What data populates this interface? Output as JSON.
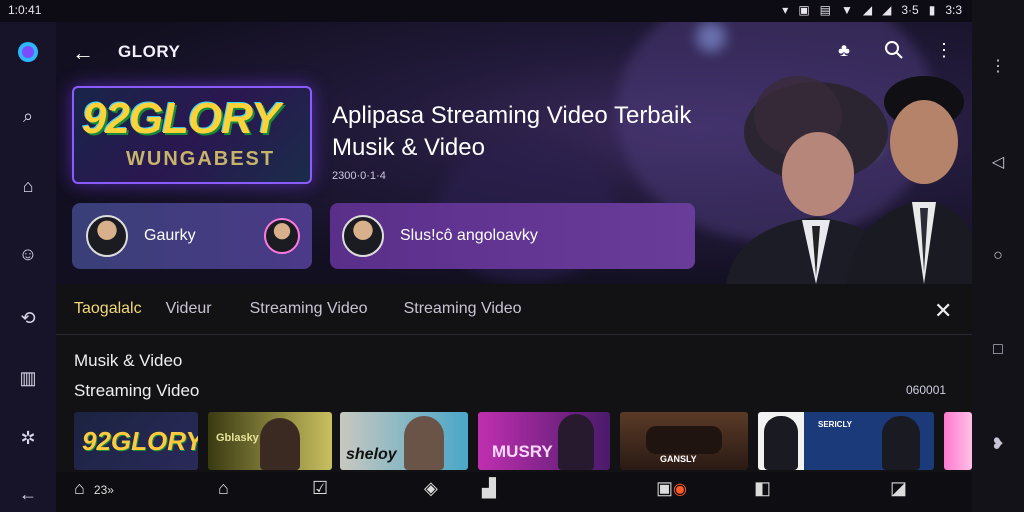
{
  "status_bar": {
    "time": "1:0:41",
    "right_items": [
      "3·5",
      "3:3"
    ]
  },
  "app_bar": {
    "title": "GLORY",
    "back_icon": "arrow-left-icon",
    "actions": [
      "share-icon",
      "search-icon",
      "more-vert-icon"
    ]
  },
  "hero": {
    "logo_main": "92GLORY",
    "logo_sub": "WUNGABEST",
    "title": "Aplipasa Streaming Video Terbaik Musik & Video",
    "meta": "2300·0·1·4",
    "cards": [
      {
        "label": "Gaurky"
      },
      {
        "label": "Slus!cô angoloavky"
      }
    ]
  },
  "tabs": [
    {
      "label": "Taogalalc",
      "active": true
    },
    {
      "label": "Videur",
      "active": false
    },
    {
      "label": "Streaming Video",
      "active": false
    },
    {
      "label": "Streaming Video",
      "active": false
    }
  ],
  "sections": {
    "musik": "Musik & Video",
    "streaming": "Streaming Video",
    "count": "060001"
  },
  "thumbnails": [
    {
      "text": "92GLORY",
      "color": "#ffc940"
    },
    {
      "text": "Gblasky",
      "color": "#e8e39a"
    },
    {
      "text": "sheloy",
      "color": "#ffffff"
    },
    {
      "text": "MUSRY",
      "color": "#ffd8ff"
    },
    {
      "text": "GANSLY",
      "color": "#ffffff"
    },
    {
      "text": "SERICLY",
      "color": "#ffffff"
    },
    {
      "text": "",
      "color": "#ffffff"
    }
  ],
  "bottom_nav": {
    "home_label": "23»",
    "icons": [
      "home-icon",
      "home-outline-icon",
      "checkbox-icon",
      "tag-icon",
      "widget-icon",
      "toggle-icon",
      "bookmark-icon",
      "chat-icon"
    ]
  },
  "colors": {
    "accent": "#f1d977",
    "rail": "#17142a",
    "panel": "#121114"
  }
}
